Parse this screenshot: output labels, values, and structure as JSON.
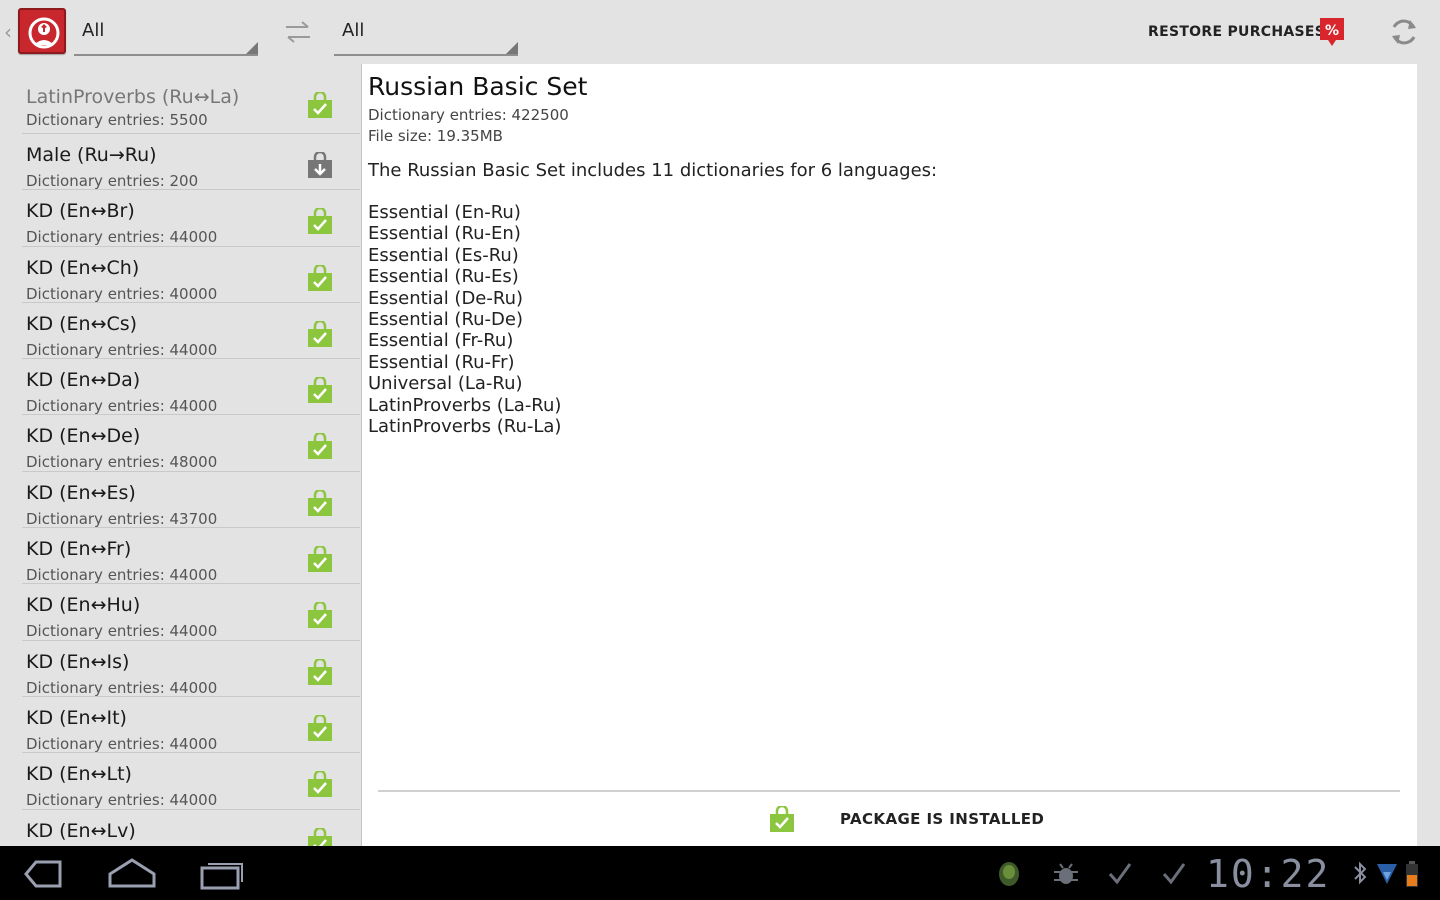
{
  "actionbar": {
    "from_filter": "All",
    "to_filter": "All",
    "restore_label": "RESTORE PURCHASES",
    "icons": [
      "app-logo-icon",
      "swap-arrows-icon",
      "sale-tag-icon",
      "refresh-icon"
    ]
  },
  "list": {
    "items": [
      {
        "name": "LatinProverbs (Ru↔La)",
        "entries": "Dictionary entries: 5500",
        "status": "installed"
      },
      {
        "name": "Male (Ru→Ru)",
        "entries": "Dictionary entries: 200",
        "status": "download"
      },
      {
        "name": "KD (En↔Br)",
        "entries": "Dictionary entries: 44000",
        "status": "installed"
      },
      {
        "name": "KD (En↔Ch)",
        "entries": "Dictionary entries: 40000",
        "status": "installed"
      },
      {
        "name": "KD (En↔Cs)",
        "entries": "Dictionary entries: 44000",
        "status": "installed"
      },
      {
        "name": "KD (En↔Da)",
        "entries": "Dictionary entries: 44000",
        "status": "installed"
      },
      {
        "name": "KD (En↔De)",
        "entries": "Dictionary entries: 48000",
        "status": "installed"
      },
      {
        "name": "KD (En↔Es)",
        "entries": "Dictionary entries: 43700",
        "status": "installed"
      },
      {
        "name": "KD (En↔Fr)",
        "entries": "Dictionary entries: 44000",
        "status": "installed"
      },
      {
        "name": "KD (En↔Hu)",
        "entries": "Dictionary entries: 44000",
        "status": "installed"
      },
      {
        "name": "KD (En↔Is)",
        "entries": "Dictionary entries: 44000",
        "status": "installed"
      },
      {
        "name": "KD (En↔It)",
        "entries": "Dictionary entries: 44000",
        "status": "installed"
      },
      {
        "name": "KD (En↔Lt)",
        "entries": "Dictionary entries: 44000",
        "status": "installed"
      },
      {
        "name": "KD (En↔Lv)",
        "entries": "",
        "status": "installed"
      }
    ]
  },
  "detail": {
    "title": "Russian Basic Set",
    "entries": "Dictionary entries: 422500",
    "file_size": "File size: 19.35MB",
    "description": "The Russian Basic Set includes 11 dictionaries for 6 languages:",
    "dictionaries": [
      "Essential (En-Ru)",
      "Essential (Ru-En)",
      "Essential (Es-Ru)",
      "Essential (Ru-Es)",
      "Essential (De-Ru)",
      "Essential (Ru-De)",
      "Essential (Fr-Ru)",
      "Essential (Ru-Fr)",
      "Universal (La-Ru)",
      "LatinProverbs (La-Ru)",
      "LatinProverbs (Ru-La)"
    ],
    "status_text": "PACKAGE IS INSTALLED"
  },
  "sysbar": {
    "time": "10:22",
    "nav_icons": [
      "back-icon",
      "home-icon",
      "recent-apps-icon"
    ],
    "tray_icons": [
      "android-icon",
      "usb-debug-icon",
      "check-icon",
      "check-icon",
      "bluetooth-icon",
      "wifi-icon",
      "battery-icon"
    ]
  },
  "colors": {
    "accent_red": "#c8282d",
    "installed_green": "#8cc63f",
    "background": "#e3e3e3"
  }
}
